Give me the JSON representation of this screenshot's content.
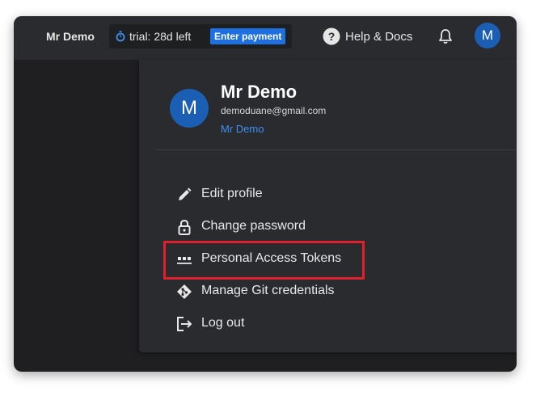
{
  "header": {
    "user_name": "Mr Demo",
    "trial_text": "trial: 28d left",
    "payment_button": "Enter payment",
    "help_label": "Help & Docs",
    "avatar_letter": "M",
    "icons": {
      "trial": "stopwatch-icon",
      "help": "question-circle-icon",
      "notifications": "bell-icon"
    }
  },
  "profile": {
    "avatar_letter": "M",
    "name": "Mr Demo",
    "email": "demoduane@gmail.com",
    "link": "Mr Demo"
  },
  "menu": {
    "items": [
      {
        "label": "Edit profile",
        "icon": "pencil-icon"
      },
      {
        "label": "Change password",
        "icon": "lock-icon"
      },
      {
        "label": "Personal Access Tokens",
        "icon": "token-dots-icon"
      },
      {
        "label": "Manage Git credentials",
        "icon": "git-icon"
      },
      {
        "label": "Log out",
        "icon": "logout-icon"
      }
    ]
  },
  "colors": {
    "accent": "#1e6fe0",
    "link": "#3d8ef0",
    "highlight": "#e0212d",
    "background": "#1f1f21",
    "panel": "#2a2b2e"
  }
}
